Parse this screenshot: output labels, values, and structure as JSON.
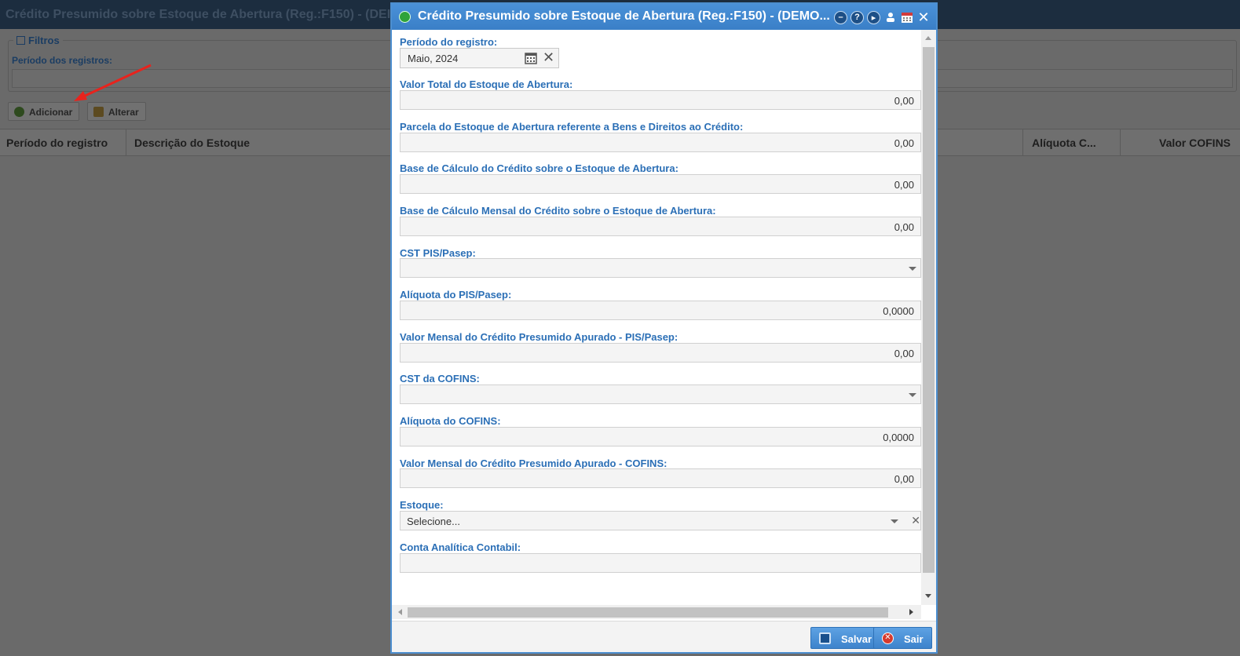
{
  "background": {
    "title": "Crédito Presumido sobre Estoque de Abertura (Reg.:F150) - (DEI",
    "filters_legend": "Filtros",
    "filter_label": "Período dos registros:",
    "toolbar": {
      "add_label": "Adicionar",
      "edit_label": "Alterar"
    },
    "grid_columns": [
      "Período do registro",
      "Descrição do Estoque",
      "Alíquota C...",
      "Valor COFINS"
    ]
  },
  "modal": {
    "title": "Crédito Presumido sobre Estoque de Abertura (Reg.:F150) - (DEMO...",
    "header_icons": [
      "minimize-icon",
      "help-icon",
      "next-icon",
      "person-icon",
      "calendar-icon",
      "close-icon"
    ],
    "fields": {
      "periodo_label": "Período do registro:",
      "periodo_value": "Maio, 2024",
      "valor_total_label": "Valor Total do Estoque de Abertura:",
      "valor_total_value": "0,00",
      "parcela_label": "Parcela do Estoque de Abertura referente a Bens e Direitos ao Crédito:",
      "parcela_value": "0,00",
      "base_calc_label": "Base de Cálculo do Crédito sobre o Estoque de Abertura:",
      "base_calc_value": "0,00",
      "base_mensal_label": "Base de Cálculo Mensal do Crédito sobre o Estoque de Abertura:",
      "base_mensal_value": "0,00",
      "cst_pis_label": "CST PIS/Pasep:",
      "cst_pis_value": "",
      "aliq_pis_label": "Alíquota do PIS/Pasep:",
      "aliq_pis_value": "0,0000",
      "valor_pis_label": "Valor Mensal do Crédito Presumido Apurado - PIS/Pasep:",
      "valor_pis_value": "0,00",
      "cst_cofins_label": "CST da COFINS:",
      "cst_cofins_value": "",
      "aliq_cofins_label": "Alíquota do COFINS:",
      "aliq_cofins_value": "0,0000",
      "valor_cofins_label": "Valor Mensal do Crédito Presumido Apurado - COFINS:",
      "valor_cofins_value": "0,00",
      "estoque_label": "Estoque:",
      "estoque_placeholder": "Selecione...",
      "conta_label": "Conta Analítica Contabil:",
      "conta_value": ""
    },
    "footer": {
      "save_label": "Salvar",
      "exit_label": "Sair"
    }
  },
  "colors": {
    "header_blue": "#3a7fc7",
    "label_blue": "#2b6fb6",
    "arrow_red": "#e8231d",
    "overlay": "#6a6a6a"
  }
}
